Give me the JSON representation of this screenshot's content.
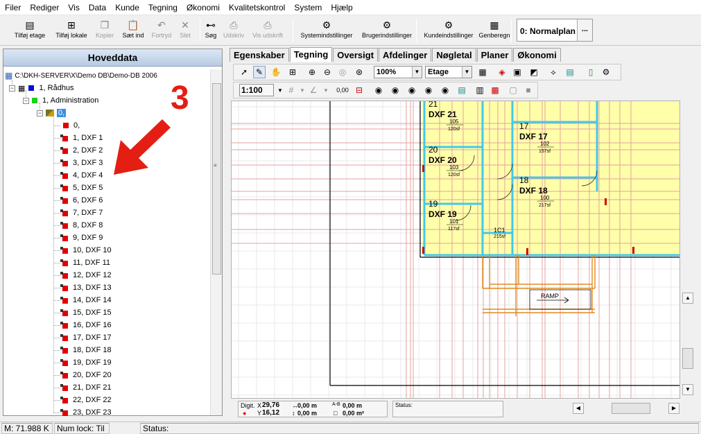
{
  "menu": [
    "Filer",
    "Rediger",
    "Vis",
    "Data",
    "Kunde",
    "Tegning",
    "Økonomi",
    "Kvalitetskontrol",
    "System",
    "Hjælp"
  ],
  "toolbar": {
    "buttons": [
      {
        "label": "Tilføj etage",
        "icon": "add-floor-icon",
        "enabled": true
      },
      {
        "label": "Tilføj lokale",
        "icon": "add-room-icon",
        "enabled": true
      },
      {
        "label": "Kopier",
        "icon": "copy-icon",
        "enabled": false
      },
      {
        "label": "Sæt ind",
        "icon": "paste-icon",
        "enabled": true
      },
      {
        "label": "Fortryd",
        "icon": "undo-icon",
        "enabled": false
      },
      {
        "label": "Slet",
        "icon": "delete-icon",
        "enabled": false
      },
      {
        "label": "Søg",
        "icon": "binoculars-icon",
        "enabled": true
      },
      {
        "label": "Udskriv",
        "icon": "print-icon",
        "enabled": false
      },
      {
        "label": "Vis udskrift",
        "icon": "print-preview-icon",
        "enabled": false
      },
      {
        "label": "Systemindstillinger",
        "icon": "system-settings-icon",
        "enabled": true
      },
      {
        "label": "Brugerindstillinger",
        "icon": "user-settings-icon",
        "enabled": true
      },
      {
        "label": "Kundeindstillinger",
        "icon": "customer-settings-icon",
        "enabled": true
      },
      {
        "label": "Genberegn",
        "icon": "calculator-icon",
        "enabled": true
      }
    ],
    "plan_selector": "0: Normalplan",
    "plan_more": "..."
  },
  "left_panel": {
    "title": "Hoveddata",
    "root": "C:\\DKH-SERVER\\X\\Demo DB\\Demo-DB 2006",
    "building": "1, Rådhus",
    "department": "1, Administration",
    "floor": "0,",
    "rooms": [
      "0,",
      "1, DXF 1",
      "2, DXF 2",
      "3, DXF 3",
      "4, DXF 4",
      "5, DXF 5",
      "6, DXF 6",
      "7, DXF 7",
      "8, DXF 8",
      "9, DXF 9",
      "10, DXF 10",
      "11, DXF 11",
      "12, DXF 12",
      "13, DXF 13",
      "14, DXF 14",
      "15, DXF 15",
      "16, DXF 16",
      "17, DXF 17",
      "18, DXF 18",
      "19, DXF 19",
      "20, DXF 20",
      "21, DXF 21",
      "22, DXF 22",
      "23, DXF 23"
    ],
    "expander": "−"
  },
  "annotation": {
    "number": "3",
    "color": "#e41e13"
  },
  "tabs": [
    "Egenskaber",
    "Tegning",
    "Oversigt",
    "Afdelinger",
    "Nøgletal",
    "Planer",
    "Økonomi"
  ],
  "active_tab": "Tegning",
  "drawing_tools": {
    "zoom": "100%",
    "layer": "Etage",
    "scale": "1:100",
    "snap": "0,00"
  },
  "drawing": {
    "rooms": [
      {
        "num": "21",
        "name": "DXF 21",
        "area": "105",
        "sub": "120sf"
      },
      {
        "num": "17",
        "name": "DXF 17",
        "area": "102",
        "sub": "157sf"
      },
      {
        "num": "20",
        "name": "DXF 20",
        "area": "103",
        "sub": "120sf"
      },
      {
        "num": "18",
        "name": "DXF 18",
        "area": "100",
        "sub": "217sf"
      },
      {
        "num": "19",
        "name": "DXF 19",
        "area": "101",
        "sub": "117sf"
      }
    ],
    "corridor": {
      "name": "1C1",
      "sub": "215sf"
    },
    "ramp": "RAMP",
    "fill_color": "#ffffaa",
    "wall_color": "#44c8e8",
    "grid_color": "#e6a0a0",
    "stair_color": "#e08a20"
  },
  "coords": {
    "label": "Digit.",
    "x_label": "X",
    "x": "29,76",
    "y_label": "Y",
    "y": "16,12",
    "dist1": "0,00 m",
    "dist2": "0,00 m",
    "a_label": "A-B",
    "a": "0,00 m",
    "area": "0,00 m²"
  },
  "draw_status_label": "Status:",
  "statusbar": {
    "memory": "M: 71.988 K",
    "numlock": "Num lock: Til",
    "status": "Status:"
  }
}
